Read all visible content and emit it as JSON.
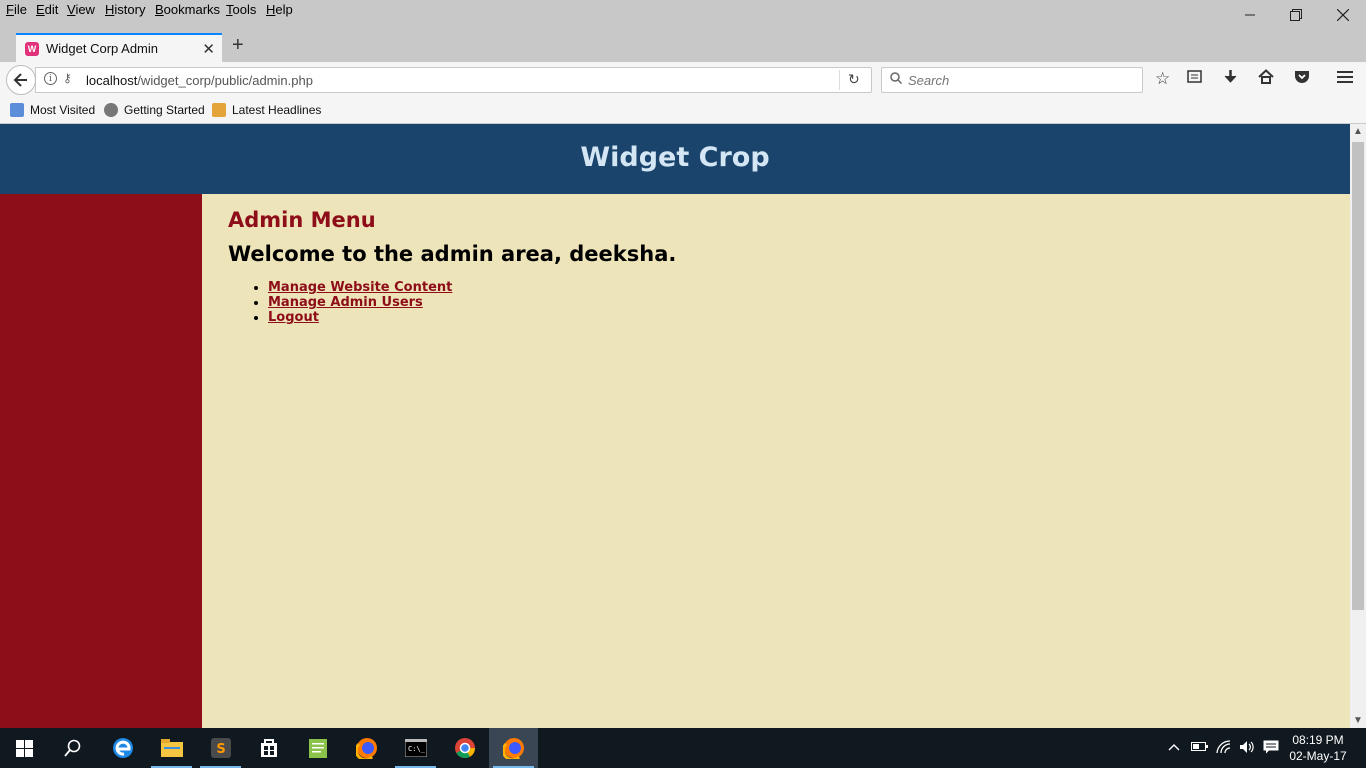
{
  "menubar": {
    "items": [
      "File",
      "Edit",
      "View",
      "History",
      "Bookmarks",
      "Tools",
      "Help"
    ]
  },
  "tab": {
    "title": "Widget Corp Admin"
  },
  "navbar": {
    "url_host": "localhost",
    "url_path": "/widget_corp/public/admin.php",
    "search_placeholder": "Search"
  },
  "bookmarks": {
    "items": [
      "Most Visited",
      "Getting Started",
      "Latest Headlines"
    ]
  },
  "page": {
    "site_title": "Widget Crop",
    "menu_heading": "Admin Menu",
    "welcome": "Welcome to the admin area, deeksha.",
    "links": [
      "Manage Website Content",
      "Manage Admin Users",
      "Logout"
    ]
  },
  "taskbar": {
    "apps": [
      "start-icon",
      "search-icon",
      "edge-icon",
      "file-explorer-icon",
      "sublime-text-icon",
      "store-icon",
      "notepad-icon",
      "firefox-icon",
      "terminal-icon",
      "chrome-icon",
      "firefox-active-icon"
    ],
    "time": "08:19 PM",
    "date": "02-May-17"
  },
  "colors": {
    "header_bg": "#1a446c",
    "header_text": "#d4e6f4",
    "sidebar_bg": "#8d0d19",
    "content_bg": "#eee4b9",
    "accent_link": "#8d0d19"
  }
}
